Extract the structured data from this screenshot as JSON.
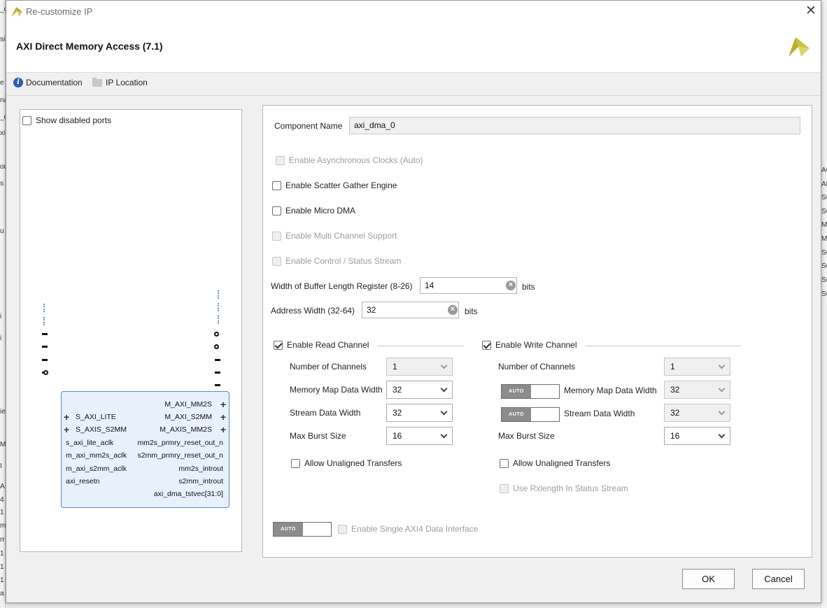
{
  "window": {
    "title": "Re-customize IP",
    "close": "✕"
  },
  "header": {
    "ip_title": "AXI Direct Memory Access (7.1)",
    "documentation": "Documentation",
    "ip_location": "IP Location"
  },
  "left_panel": {
    "show_disabled_ports": "Show disabled ports",
    "symbol": {
      "left_ports": [
        "S_AXI_LITE",
        "S_AXIS_S2MM",
        "s_axi_lite_aclk",
        "m_axi_mm2s_aclk",
        "m_axi_s2mm_aclk",
        "axi_resetn"
      ],
      "right_ports": [
        "M_AXI_MM2S",
        "M_AXI_S2MM",
        "M_AXIS_MM2S",
        "mm2s_prmry_reset_out_n",
        "s2mm_prmry_reset_out_n",
        "mm2s_introut",
        "s2mm_introut",
        "axi_dma_tstvec[31:0]"
      ]
    }
  },
  "config": {
    "component_name_label": "Component Name",
    "component_name_value": "axi_dma_0",
    "async_clocks": "Enable Asynchronous Clocks (Auto)",
    "scatter_gather": "Enable Scatter Gather Engine",
    "micro_dma": "Enable Micro DMA",
    "multi_channel": "Enable Multi Channel Support",
    "control_status": "Enable Control / Status Stream",
    "buffer_length_label": "Width of Buffer Length Register (8-26)",
    "buffer_length_value": "14",
    "address_width_label": "Address Width (32-64)",
    "address_width_value": "32",
    "bits": "bits",
    "read_channel": {
      "title": "Enable Read Channel",
      "num_channels_label": "Number of Channels",
      "num_channels": "1",
      "mm_width_label": "Memory Map Data Width",
      "mm_width": "32",
      "stream_width_label": "Stream Data Width",
      "stream_width": "32",
      "burst_label": "Max Burst Size",
      "burst": "16",
      "unaligned": "Allow Unaligned Transfers"
    },
    "write_channel": {
      "title": "Enable Write Channel",
      "num_channels_label": "Number of Channels",
      "num_channels": "1",
      "mm_width_label": "Memory Map Data Width",
      "mm_width": "32",
      "stream_width_label": "Stream Data Width",
      "stream_width": "32",
      "burst_label": "Max Burst Size",
      "burst": "16",
      "unaligned": "Allow Unaligned Transfers",
      "rxlength": "Use Rxlength In Status Stream"
    },
    "auto_label": "AUTO",
    "single_axi4": "Enable Single AXI4 Data Interface"
  },
  "buttons": {
    "ok": "OK",
    "cancel": "Cancel"
  },
  "background_text": {
    "left": [
      "_o",
      "si",
      "e",
      "na",
      "_c",
      "xi",
      "ou",
      "s",
      "u",
      "i",
      "i",
      "ie",
      "M",
      "I",
      "A",
      "4",
      "1",
      "mi",
      "rr",
      "1",
      "1",
      "1",
      "a"
    ],
    "right": [
      "AC",
      "AR",
      "SO",
      "SO",
      "MO",
      "MO",
      "SO",
      "SO",
      "SO",
      "SO"
    ]
  },
  "colors": {
    "accent_blue": "#2a5faf",
    "symbol_fill": "#e8f0fb",
    "symbol_border": "#5b87c0",
    "logo_yellow": "#c9c23a"
  }
}
